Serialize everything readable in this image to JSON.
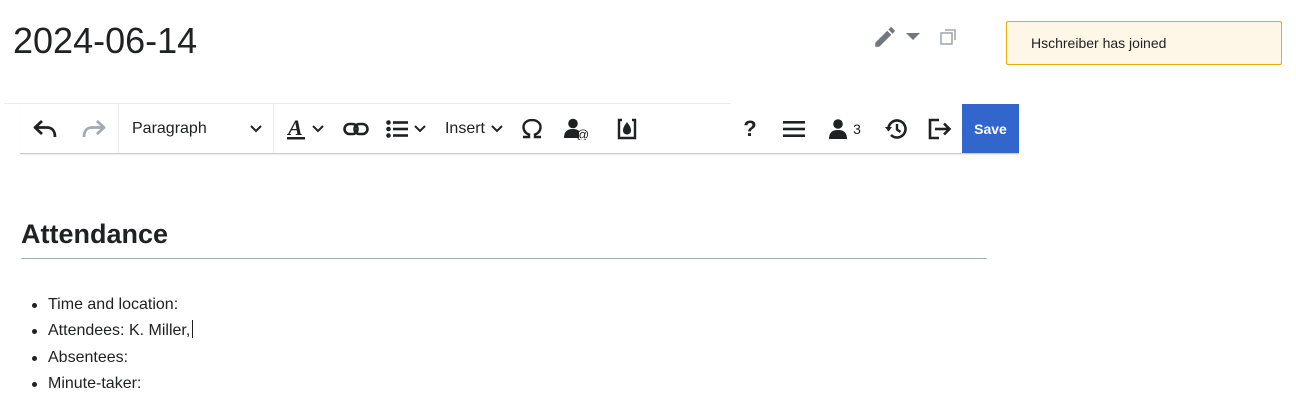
{
  "page": {
    "title": "2024-06-14"
  },
  "title_actions": {
    "edit_icon": "pencil-icon",
    "menu_icon": "caret-down-icon",
    "expand_icon": "expand-icon"
  },
  "notification": {
    "text": "Hschreiber has joined"
  },
  "toolbar": {
    "undo_icon": "undo-icon",
    "redo_icon": "redo-icon",
    "format_label": "Paragraph",
    "text_style_icon": "text-style-icon",
    "link_icon": "link-icon",
    "list_icon": "bullet-list-icon",
    "insert_label": "Insert",
    "special_chars_icon": "omega-icon",
    "mention_icon": "user-mention-icon",
    "signature_icon": "signature-icon",
    "help_label": "?",
    "menu_icon": "hamburger-icon",
    "users_icon": "user-icon",
    "users_count": "3",
    "history_icon": "history-icon",
    "exit_icon": "exit-icon",
    "save_label": "Save"
  },
  "colors": {
    "accent": "#3366cc",
    "notification_bg": "#fef6e7",
    "notification_border": "#edab00",
    "text": "#202122"
  },
  "content": {
    "heading": "Attendance",
    "items": [
      {
        "text": "Time and location:"
      },
      {
        "text": "Attendees: K. Miller,"
      },
      {
        "text": "Absentees:"
      },
      {
        "text": "Minute-taker:"
      }
    ]
  }
}
